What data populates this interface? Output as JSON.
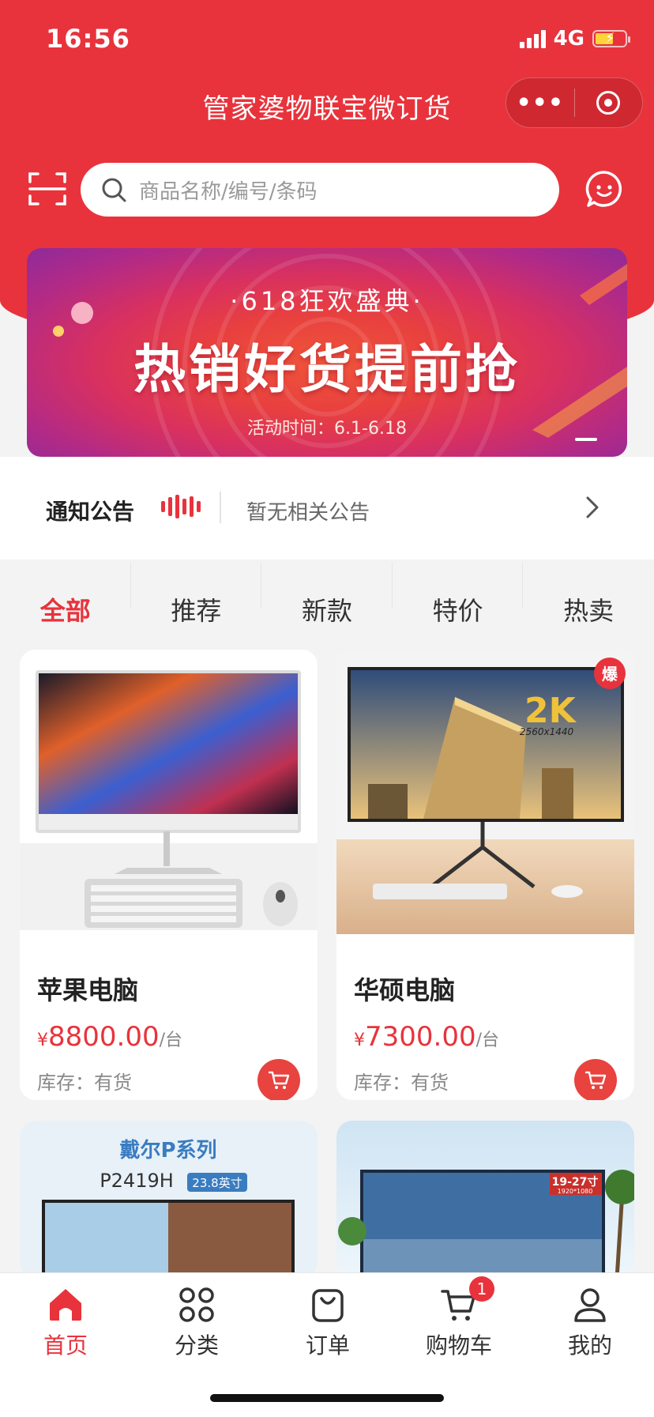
{
  "status": {
    "time": "16:56",
    "network": "4G"
  },
  "nav": {
    "title": "管家婆物联宝微订货",
    "more_icon": "more-dots-icon",
    "close_icon": "target-icon"
  },
  "search": {
    "placeholder": "商品名称/编号/条码"
  },
  "banner": {
    "subtitle": "·618狂欢盛典·",
    "headline": "热销好货提前抢",
    "period": "活动时间：6.1-6.18"
  },
  "notice": {
    "title": "通知公告",
    "text": "暂无相关公告"
  },
  "tabs": [
    "全部",
    "推荐",
    "新款",
    "特价",
    "热卖"
  ],
  "products": [
    {
      "name": "苹果电脑",
      "currency": "¥",
      "price": "8800.00",
      "unit": "/台",
      "stock": "库存：有货"
    },
    {
      "name": "华硕电脑",
      "currency": "¥",
      "price": "7300.00",
      "unit": "/台",
      "stock": "库存：有货",
      "hot_tag": "爆",
      "resolution_tag": "2K",
      "resolution_sub": "2560x1440"
    },
    {
      "brand": "戴尔P系列",
      "model": "P2419H",
      "size_tag": "23.8英寸"
    },
    {
      "size_tag": "19-27寸",
      "size_sub": "1920*1080"
    }
  ],
  "bottom_nav": [
    {
      "label": "首页",
      "icon": "home-icon"
    },
    {
      "label": "分类",
      "icon": "grid-icon"
    },
    {
      "label": "订单",
      "icon": "order-bag-icon"
    },
    {
      "label": "购物车",
      "icon": "cart-icon",
      "badge": "1"
    },
    {
      "label": "我的",
      "icon": "user-icon"
    }
  ],
  "colors": {
    "brand": "#e8333c",
    "background": "#f3f3f3"
  }
}
